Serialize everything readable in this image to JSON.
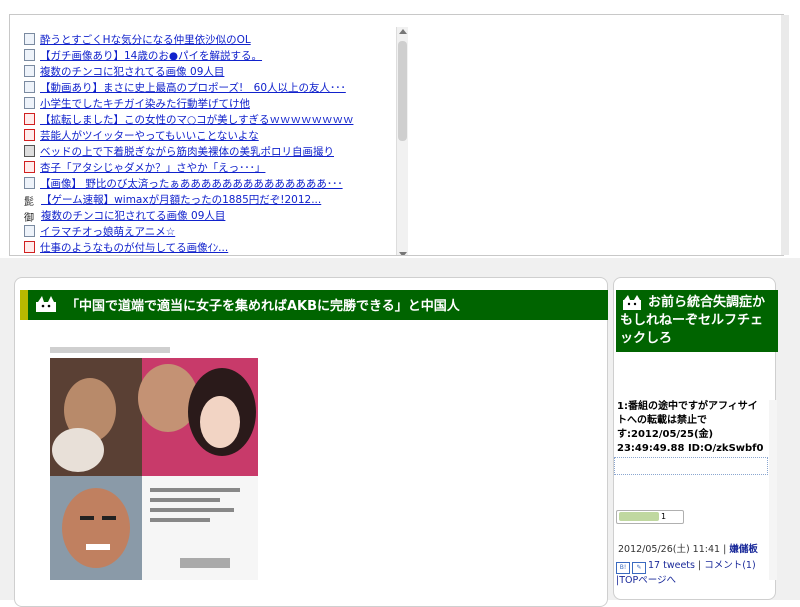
{
  "link_list": [
    {
      "icon": "blue-page-icon",
      "label": "酔うとすごくHな気分になる仲里依沙似のOL"
    },
    {
      "icon": "page-icon",
      "label": "【ガチ画像あり】14歳のお●パイを解説する。"
    },
    {
      "icon": "page-icon",
      "label": "複数のチンコに犯されてる画像 09人目"
    },
    {
      "icon": "page-icon",
      "label": "【動画あり】まさに史上最高のプロポーズ!　60人以上の友人･･･"
    },
    {
      "icon": "page-icon",
      "label": "小学生でしたキチガイ染みた行動挙げてけ他"
    },
    {
      "icon": "red-logo-icon",
      "label": "【拡転しました】この女性のマ○コが美しすぎるｗｗｗｗｗｗｗｗ"
    },
    {
      "icon": "red-logo-icon",
      "label": "芸能人がツイッターやってもいいことないよな"
    },
    {
      "icon": "camera-icon",
      "label": "ベッドの上で下着脱ぎながら筋肉美裸体の美乳ポロリ自画撮り"
    },
    {
      "icon": "red-logo-icon",
      "label": "杏子「アタシじゃダメか？」さやか「えっ･･･」"
    },
    {
      "icon": "page-icon",
      "label": "【画像】 野比のび太済ったぁああああああああああああああ･･･"
    },
    {
      "icon": "kanji-logo-icon",
      "label": "【ゲーム速報】wimaxが月額たったの1885円だぞ!2012..."
    },
    {
      "icon": "kanji-go-icon",
      "label": "複数のチンコに犯されてる画像 09人目"
    },
    {
      "icon": "page-icon",
      "label": "イラマチオっ娘萌えアニメ☆"
    },
    {
      "icon": "red-logo-icon",
      "label": "仕事のようなものが付与してる画像ｲﾝ..."
    }
  ],
  "article": {
    "title": "「中国で道端で適当に女子を集めればAKBに完勝できる」と中国人"
  },
  "sidebar": {
    "title": "お前ら統合失調症かもしれねーぞセルフチェックしろ",
    "post_text": "1:番組の途中ですがアフィサイトへの転載は禁止です:2012/05/25(金) 23:49:49.88 ID:O/zkSwbf0",
    "like_count": "1",
    "date": "2012/05/26(土) 11:41 |",
    "category": "嫌儲板",
    "tweets": "17 tweets",
    "comment": "コメント(1)",
    "top_link": "|TOPページへ"
  }
}
